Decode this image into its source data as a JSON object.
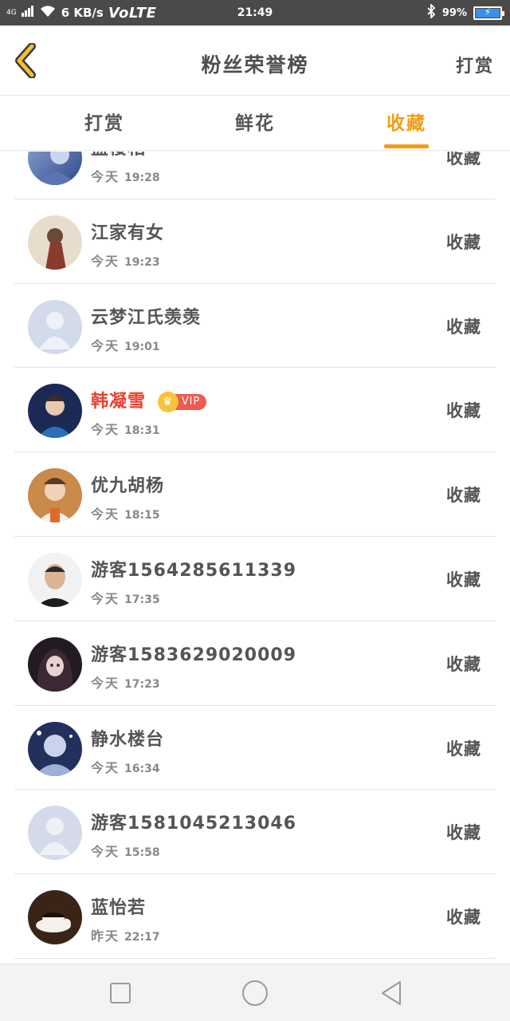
{
  "status_bar": {
    "network": "4G",
    "speed": "6 KB/s",
    "volte": "VoLTE",
    "time": "21:49",
    "battery": "99%",
    "battery_level": 0.99
  },
  "header": {
    "title": "粉丝荣誉榜",
    "action": "打赏"
  },
  "tabs": [
    {
      "label": "打赏",
      "active": false
    },
    {
      "label": "鲜花",
      "active": false
    },
    {
      "label": "收藏",
      "active": true
    }
  ],
  "rows": [
    {
      "name": "蓝楼相",
      "day": "今天",
      "time": "19:28",
      "action": "收藏",
      "vip": false
    },
    {
      "name": "江家有女",
      "day": "今天",
      "time": "19:23",
      "action": "收藏",
      "vip": false
    },
    {
      "name": "云梦江氏羡羡",
      "day": "今天",
      "time": "19:01",
      "action": "收藏",
      "vip": false
    },
    {
      "name": "韩凝雪",
      "day": "今天",
      "time": "18:31",
      "action": "收藏",
      "vip": true,
      "vip_label": "VIP"
    },
    {
      "name": "优九胡杨",
      "day": "今天",
      "time": "18:15",
      "action": "收藏",
      "vip": false
    },
    {
      "name": "游客1564285611339",
      "day": "今天",
      "time": "17:35",
      "action": "收藏",
      "vip": false
    },
    {
      "name": "游客1583629020009",
      "day": "今天",
      "time": "17:23",
      "action": "收藏",
      "vip": false
    },
    {
      "name": "静水楼台",
      "day": "今天",
      "time": "16:34",
      "action": "收藏",
      "vip": false
    },
    {
      "name": "游客1581045213046",
      "day": "今天",
      "time": "15:58",
      "action": "收藏",
      "vip": false
    },
    {
      "name": "蓝怡若",
      "day": "昨天",
      "time": "22:17",
      "action": "收藏",
      "vip": false
    }
  ],
  "colors": {
    "accent": "#f39c12",
    "vip_name": "#e8412f",
    "back_arrow": "#f2c12e"
  }
}
